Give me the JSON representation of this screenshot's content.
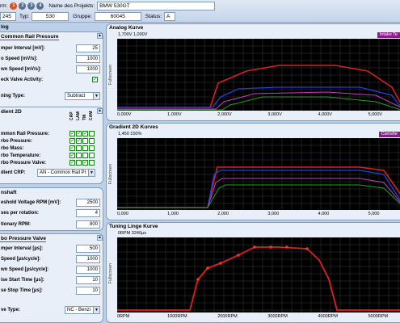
{
  "header": {
    "row1_label": "rm:",
    "steps": [
      "1",
      "2",
      "3",
      "4"
    ],
    "step_colors": [
      "#d9531e",
      "#5a6e8f",
      "#5a6e8f",
      "#5a6e8f"
    ],
    "project_label": "Name des Projekts:",
    "project_value": "BMW 530GT",
    "id_value": "245",
    "typ_label": "Typ:",
    "typ_value": "530",
    "gruppe_label": "Gruppe:",
    "gruppe_value": "60045",
    "status_label": "Status:",
    "status_value": "A"
  },
  "left": {
    "dialog_title": "log",
    "common_rail": {
      "title": "Common Rail Pressure",
      "fields": [
        {
          "label": "mper Interval [mV]:",
          "value": "25"
        },
        {
          "label": "o Speed [mV/s]:",
          "value": "1000"
        },
        {
          "label": "wn Speed [mV/s]:",
          "value": "1000"
        }
      ],
      "check_label": "eck Valve Activity:",
      "tuning_label": "ning Type:",
      "tuning_value": "Subtract"
    },
    "gradient2d": {
      "title": "dient 2D",
      "col_headers": [
        "CRP",
        "LAM",
        "TM",
        "CAM"
      ],
      "rows": [
        {
          "label": "mmon Rail Pressure:",
          "checks": [
            true,
            true,
            true,
            false
          ]
        },
        {
          "label": "rbo Pressure:",
          "checks": [
            true,
            true,
            false,
            false
          ]
        },
        {
          "label": "rbo Mass:",
          "checks": [
            true,
            false,
            false,
            false
          ]
        },
        {
          "label": "rbo Temperature:",
          "checks": [
            true,
            false,
            false,
            false
          ]
        },
        {
          "label": "rbo Pressure Valve:",
          "checks": [
            true,
            false,
            true,
            false
          ]
        }
      ],
      "select_label": "dient CRP:",
      "select_value": "AN - Common Rail Pr"
    },
    "camshaft": {
      "title": "nshaft",
      "fields": [
        {
          "label": "eshold Voltage RPM [mV]:",
          "value": "2500"
        },
        {
          "label": "ses per rotation:",
          "value": "4"
        },
        {
          "label": "tionary RPM:",
          "value": "800"
        }
      ]
    },
    "turbo_valve": {
      "title": "bo Pressure Valve",
      "fields": [
        {
          "label": "mper Interval [µs]:",
          "value": "500"
        },
        {
          "label": "Speed [µs/cycle]:",
          "value": "1000"
        },
        {
          "label": "wn Speed [µs/cycle]:",
          "value": "1000"
        },
        {
          "label": "ise Start Time [µs]:",
          "value": "10"
        },
        {
          "label": "se Stop Time [µs]:",
          "value": "10"
        }
      ],
      "type_label": "ve Type:",
      "type_value": "NC - Benzi"
    }
  },
  "charts": {
    "analog": {
      "title": "Analog Kurve",
      "sub": "1,700V  1,000V",
      "legend": "Intake Te",
      "ylabel": "Fullscreen",
      "xticks": [
        "0,000V",
        "1,000V",
        "2,000V",
        "3,000V",
        "4,000V",
        "5,000V"
      ]
    },
    "gradient": {
      "title": "Gradient 2D Kurves",
      "sub": "1,450  150%",
      "legend": "Camshe",
      "ylabel": "Fullscreen",
      "xticks": [
        "0,000",
        "1,000",
        "2,000",
        "3,000",
        "4,000",
        "5,000"
      ]
    },
    "tuning": {
      "title": "Tuning Linge Kurve",
      "sub": "0RPM  3240µs",
      "ylabel": "Fullscreen",
      "xticks": [
        "0RPM",
        "1000RPM",
        "2000RPM",
        "3000RPM",
        "4000RPM",
        "5000RPM"
      ]
    }
  }
}
